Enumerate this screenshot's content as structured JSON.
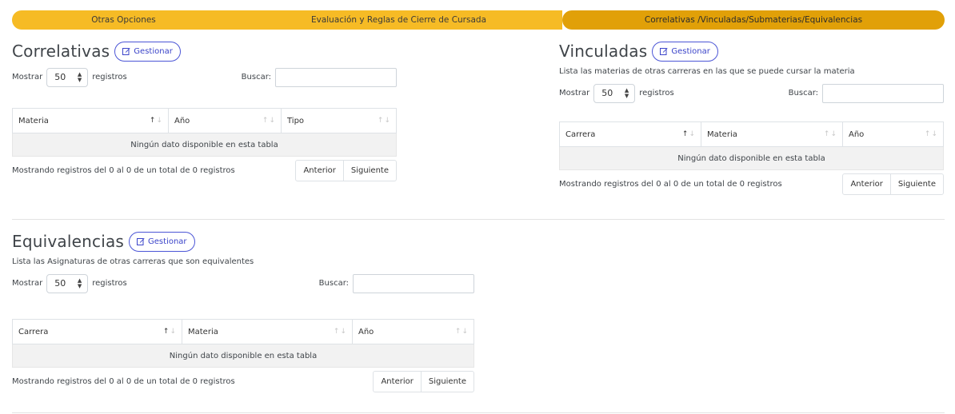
{
  "tabs": [
    {
      "label": "Otras Opciones"
    },
    {
      "label": "Evaluación y Reglas de Cierre de Cursada"
    },
    {
      "label": "Correlativas /Vinculadas/Submaterias/Equivalencias"
    }
  ],
  "correlativas": {
    "title": "Correlativas",
    "button": "Gestionar",
    "show_label": "Mostrar",
    "show_value": "50",
    "records_label": "registros",
    "search_label": "Buscar:",
    "search_value": "",
    "columns": [
      "Materia",
      "Año",
      "Tipo"
    ],
    "empty": "Ningún dato disponible en esta tabla",
    "info": "Mostrando registros del 0 al 0 de un total de 0 registros",
    "prev": "Anterior",
    "next": "Siguiente"
  },
  "vinculadas": {
    "title": "Vinculadas",
    "button": "Gestionar",
    "description": "Lista las materias de otras carreras en las que se puede cursar la materia",
    "show_label": "Mostrar",
    "show_value": "50",
    "records_label": "registros",
    "search_label": "Buscar:",
    "search_value": "",
    "columns": [
      "Carrera",
      "Materia",
      "Año"
    ],
    "empty": "Ningún dato disponible en esta tabla",
    "info": "Mostrando registros del 0 al 0 de un total de 0 registros",
    "prev": "Anterior",
    "next": "Siguiente"
  },
  "equivalencias": {
    "title": "Equivalencias",
    "button": "Gestionar",
    "description": "Lista las Asignaturas de otras carreras que son equivalentes",
    "show_label": "Mostrar",
    "show_value": "50",
    "records_label": "registros",
    "search_label": "Buscar:",
    "search_value": "",
    "columns": [
      "Carrera",
      "Materia",
      "Año"
    ],
    "empty": "Ningún dato disponible en esta tabla",
    "info": "Mostrando registros del 0 al 0 de un total de 0 registros",
    "prev": "Anterior",
    "next": "Siguiente"
  },
  "icons": {
    "edit": "edit-icon",
    "sort": "sort-arrows-icon",
    "select": "select-caret-icon"
  },
  "colors": {
    "tab": "#f6bb25",
    "tab_active": "#e1a008",
    "button_accent": "#3b44c9"
  }
}
